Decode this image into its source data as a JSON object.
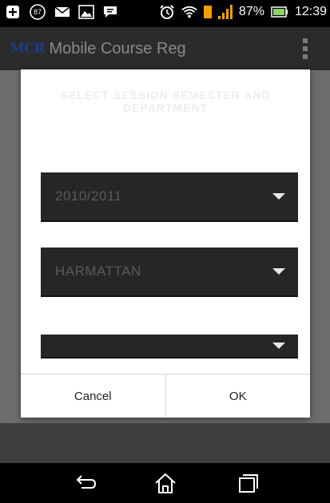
{
  "status_bar": {
    "notification_badge": "87",
    "battery_percent": "87%",
    "time": "12:39",
    "icons": [
      "plus-icon",
      "badge-icon",
      "mail-icon",
      "image-icon",
      "chat-icon",
      "alarm-icon",
      "wifi-icon",
      "sim-icon",
      "signal-icon",
      "battery-icon"
    ]
  },
  "action_bar": {
    "logo": "MCR",
    "title": "Mobile Course Reg",
    "overflow_icon": "overflow-menu-icon"
  },
  "dialog": {
    "title_line1": "SELECT SESSION SEMESTER AND",
    "title_line2": "DEPARTMENT",
    "session_value": "2010/2011",
    "semester_value": "HARMATTAN",
    "department_value": "",
    "cancel_label": "Cancel",
    "ok_label": "OK"
  },
  "nav_bar": {
    "icons": [
      "back-icon",
      "home-icon",
      "recent-apps-icon"
    ]
  }
}
